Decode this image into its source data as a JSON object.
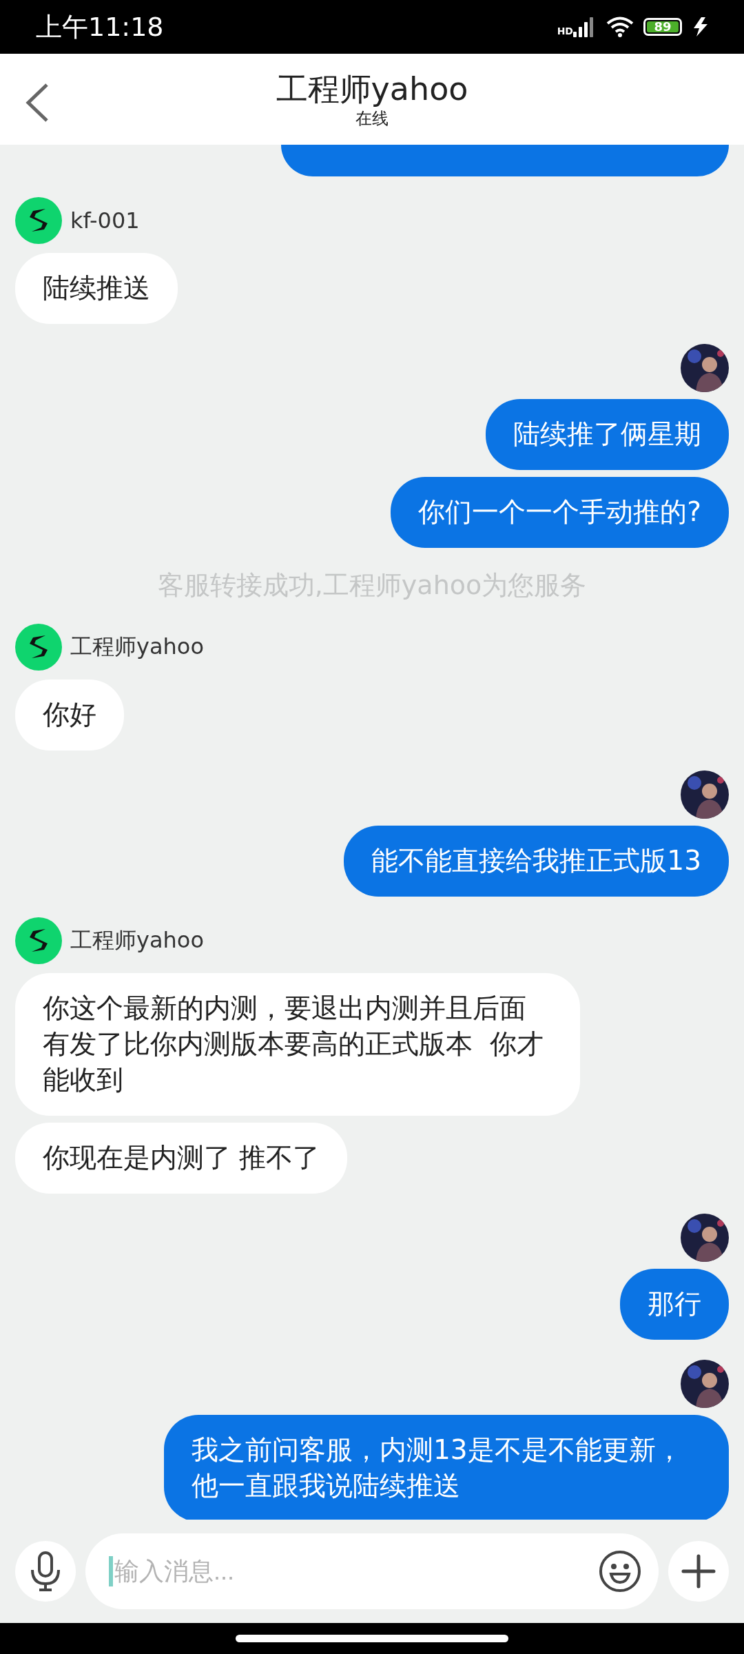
{
  "status_bar": {
    "time": "上午11:18",
    "network_label": "HD",
    "battery": "89"
  },
  "header": {
    "title": "工程师yahoo",
    "subtitle": "在线"
  },
  "messages": [
    {
      "kind": "outgoing",
      "show_avatar": false,
      "bubbles": [
        {
          "kind": "cut"
        }
      ]
    },
    {
      "kind": "incoming",
      "sender": "kf-001",
      "bubbles": [
        {
          "text": "陆续推送"
        }
      ]
    },
    {
      "kind": "outgoing",
      "show_avatar": true,
      "bubbles": [
        {
          "text": "陆续推了俩星期"
        },
        {
          "text": "你们一个一个手动推的?"
        }
      ]
    },
    {
      "kind": "system",
      "text": "客服转接成功,工程师yahoo为您服务"
    },
    {
      "kind": "incoming",
      "sender": "工程师yahoo",
      "bubbles": [
        {
          "text": "你好"
        }
      ]
    },
    {
      "kind": "outgoing",
      "show_avatar": true,
      "bubbles": [
        {
          "text": "能不能直接给我推正式版13"
        }
      ]
    },
    {
      "kind": "incoming",
      "sender": "工程师yahoo",
      "bubbles": [
        {
          "text": "你这个最新的内测，要退出内测并且后面有发了比你内测版本要高的正式版本  你才能收到"
        },
        {
          "text": "你现在是内测了 推不了"
        }
      ]
    },
    {
      "kind": "outgoing",
      "show_avatar": true,
      "bubbles": [
        {
          "text": "那行"
        }
      ]
    },
    {
      "kind": "outgoing",
      "show_avatar": true,
      "bubbles": [
        {
          "text": "我之前问客服，内测13是不是不能更新，他一直跟我说陆续推送"
        }
      ]
    }
  ],
  "composer": {
    "placeholder": "输入消息..."
  }
}
